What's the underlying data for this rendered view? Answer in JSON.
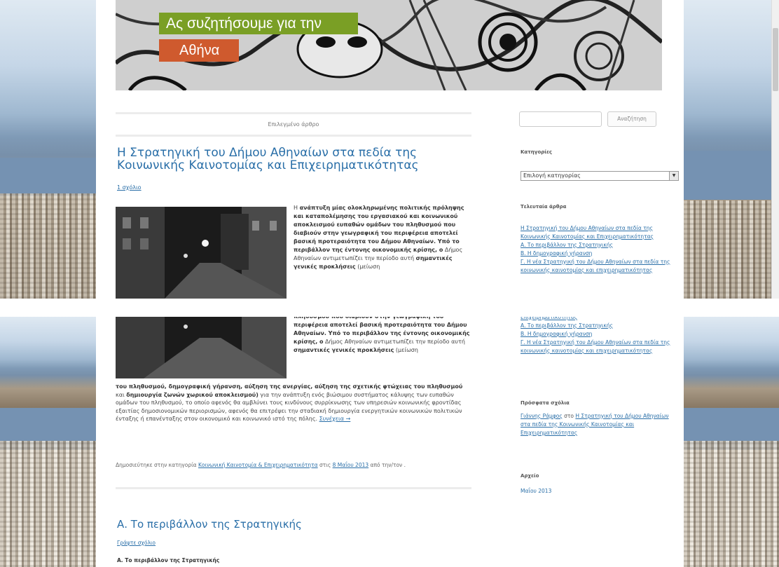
{
  "header": {
    "site_title": "Ας συζητήσουμε για την",
    "site_description": "Αθήνα"
  },
  "featured": {
    "label": "Επιλεγμένο άρθρο"
  },
  "post1": {
    "title_line1": "Η Στρατηγική του Δήμου Αθηναίων στα πεδία της",
    "title_line2": "Κοινωνικής Καινοτομίας και Επιχειρηματικότητας",
    "comments_link": "1 σχόλιο",
    "ex_1": "Η ",
    "ex_2": "ανάπτυξη μίας ολοκληρωμένης πολιτικής πρόληψης και καταπολέμησης του εργασιακού και κοινωνικού αποκλεισμού ευπαθών ομάδων του πληθυσμού που διαβιούν στην γεωγραφική του περιφέρεια αποτελεί βασική προτεραιότητα του Δήμου Αθηναίων. Υπό το περιβάλλον της έντονης οικονομικής κρίσης, ο",
    "ex_3": " Δήμος Αθηναίων αντιμετωπίζει την περίοδο αυτή ",
    "ex_4": "σημαντικές γενικές προκλήσεις",
    "ex_5": " (μείωση",
    "p_1": "του πληθυσμού, δημογραφική γήρανση, αύξηση της ανεργίας, αύξηση της σχετικής φτώχειας του πληθυσμού",
    "p_2": " και ",
    "p_3": "δημιουργία ζωνών χωρικού αποκλεισμού)",
    "p_4": " για την ανάπτυξη ενός βιώσιμου συστήματος κάλυψης των ευπαθών ομάδων του πληθυσμού, το οποίο αφενός θα αμβλύνει τους κινδύνους συρρίκνωσης των υπηρεσιών κοινωνικής φροντίδας εξαιτίας δημοσιονομικών περιορισμών, αφενός θα επιτρέψει την σταδιακή δημιουργία ενεργητικών κοινωνικών πολιτικών ένταξης ή επανένταξης στον οικονομικό και κοινωνικό ιστό της πόλης. ",
    "continue_link": "Συνέχεια →",
    "meta_1": "Δημοσιεύτηκε στην κατηγορία ",
    "meta_category": "Κοινωνική Καινοτομία & Επιχειρηματικότητα",
    "meta_2": " στις ",
    "meta_date": "8 Μαΐου 2013",
    "meta_3": " από την/τον ."
  },
  "post2": {
    "title": "Α. Το περιβάλλον της Στρατηγικής",
    "write_comment": "Γράψτε σχόλιο",
    "subheading": "Α. Το περιβάλλον της Στρατηγικής"
  },
  "sidebar": {
    "search_button": "Αναζήτηση",
    "categories_heading": "Κατηγορίες",
    "categories_select": "Επιλογή κατηγορίας",
    "recent_posts_heading": "Τελευταία άρθρα",
    "recent_posts": [
      "Η Στρατηγική του Δήμου Αθηναίων στα πεδία της Κοινωνικής Καινοτομίας και Επιχειρηματικότητας",
      "Α. Το περιβάλλον της Στρατηγικής",
      "Β. Η δημογραφική γήρανση",
      "Γ. Η νέα Στρατηγική του Δήμου Αθηναίων στα πεδία της κοινωνικής καινοτομίας και επιχειρηματικότητας"
    ],
    "recent_comments_heading": "Πρόσφατα σχόλια",
    "rc_author": "Γιάννης Ράμφος",
    "rc_on": " στο ",
    "rc_post": "Η Στρατηγική του Δήμου Αθηναίων στα πεδία της Κοινωνικής Καινοτομίας και Επιχειρηματικότητας",
    "archives_heading": "Αρχείο",
    "archive_month": "Μαΐου 2013"
  },
  "colors": {
    "title_bg": "#7a9f25",
    "desc_bg": "#cf5a2e",
    "link": "#2a6fa8"
  }
}
